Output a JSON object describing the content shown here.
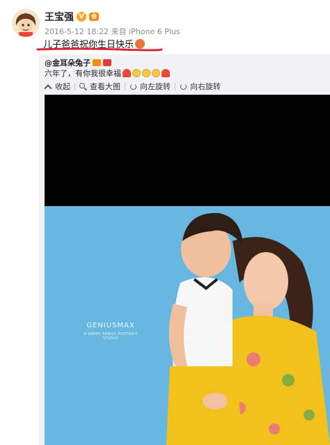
{
  "post": {
    "author": "王宝强",
    "verified_mark": "V",
    "member_badge": "会",
    "meta": "2016-5-12 18:22 来自 iPhone 6 Plus",
    "text": "儿子爸爸祝你生日快乐",
    "avatar_icon": "cartoon-avatar-icon"
  },
  "repost": {
    "author": "@金耳朵兔子",
    "text": "六年了，有你我很幸福",
    "emojis": [
      "heart-icon",
      "smile-icon",
      "smile-icon",
      "smile-icon",
      "heart-icon"
    ],
    "toolbar": {
      "collapse": "收起",
      "view_large": "查看大图",
      "rotate_left": "向左旋转",
      "rotate_right": "向右旋转"
    }
  },
  "photo": {
    "watermark_main": "GENIUSMAX",
    "watermark_sub": "A HAPPY FAMILY PORTRAIT STUDIO"
  },
  "colors": {
    "underline": "#d9263a",
    "photo_bg": "#67b7e0",
    "dress": "#f2c21a",
    "black_bar": "#000000"
  }
}
